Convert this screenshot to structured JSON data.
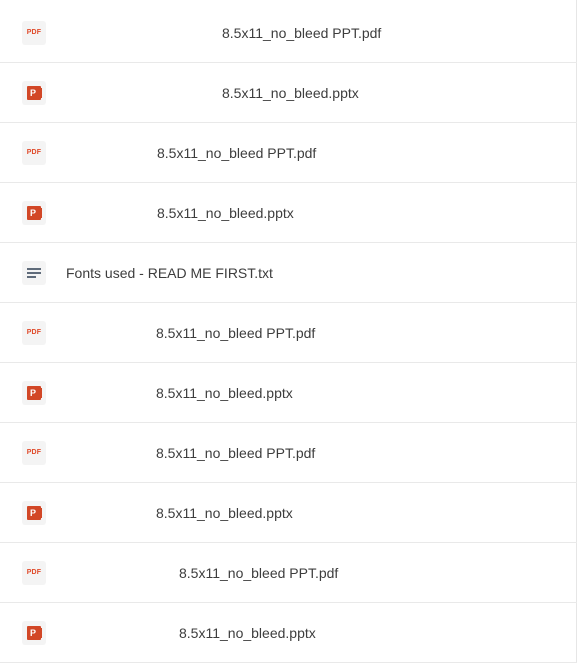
{
  "files": [
    {
      "name": "8.5x11_no_bleed PPT.pdf",
      "type": "pdf",
      "icon": "pdf-icon",
      "icon_text": "PDF"
    },
    {
      "name": "8.5x11_no_bleed.pptx",
      "type": "pptx",
      "icon": "powerpoint-icon",
      "icon_text": "P"
    },
    {
      "name": "8.5x11_no_bleed PPT.pdf",
      "type": "pdf",
      "icon": "pdf-icon",
      "icon_text": "PDF"
    },
    {
      "name": "8.5x11_no_bleed.pptx",
      "type": "pptx",
      "icon": "powerpoint-icon",
      "icon_text": "P"
    },
    {
      "name": "Fonts used - READ ME FIRST.txt",
      "type": "txt",
      "icon": "text-file-icon"
    },
    {
      "name": "8.5x11_no_bleed PPT.pdf",
      "type": "pdf",
      "icon": "pdf-icon",
      "icon_text": "PDF"
    },
    {
      "name": "8.5x11_no_bleed.pptx",
      "type": "pptx",
      "icon": "powerpoint-icon",
      "icon_text": "P"
    },
    {
      "name": "8.5x11_no_bleed PPT.pdf",
      "type": "pdf",
      "icon": "pdf-icon",
      "icon_text": "PDF"
    },
    {
      "name": "8.5x11_no_bleed.pptx",
      "type": "pptx",
      "icon": "powerpoint-icon",
      "icon_text": "P"
    },
    {
      "name": "8.5x11_no_bleed PPT.pdf",
      "type": "pdf",
      "icon": "pdf-icon",
      "icon_text": "PDF"
    },
    {
      "name": "8.5x11_no_bleed.pptx",
      "type": "pptx",
      "icon": "powerpoint-icon",
      "icon_text": "P"
    }
  ],
  "colors": {
    "pdf": "#e04a2a",
    "pptx": "#d24726",
    "txt": "#5f6b7a",
    "text": "#3d3d3d",
    "divider": "#e9e9e9"
  }
}
